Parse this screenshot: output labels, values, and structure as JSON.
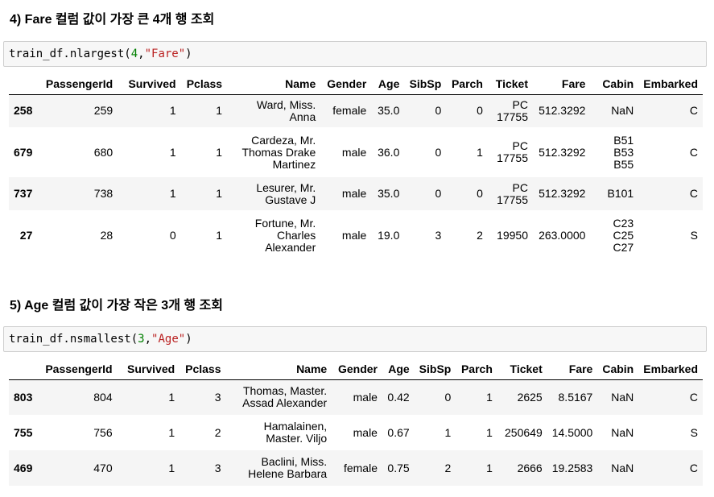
{
  "section4": {
    "heading": "4) Fare 컬럼 값이 가장 큰 4개 행 조회",
    "code": {
      "obj": "train_df.nlargest(",
      "num": "4",
      "comma": ",",
      "str": "\"Fare\"",
      "close": ")"
    },
    "columns": [
      "",
      "PassengerId",
      "Survived",
      "Pclass",
      "Name",
      "Gender",
      "Age",
      "SibSp",
      "Parch",
      "Ticket",
      "Fare",
      "Cabin",
      "Embarked"
    ],
    "rows": [
      [
        "258",
        "259",
        "1",
        "1",
        "Ward, Miss. Anna",
        "female",
        "35.0",
        "0",
        "0",
        "PC 17755",
        "512.3292",
        "NaN",
        "C"
      ],
      [
        "679",
        "680",
        "1",
        "1",
        "Cardeza, Mr. Thomas Drake Martinez",
        "male",
        "36.0",
        "0",
        "1",
        "PC 17755",
        "512.3292",
        "B51 B53 B55",
        "C"
      ],
      [
        "737",
        "738",
        "1",
        "1",
        "Lesurer, Mr. Gustave J",
        "male",
        "35.0",
        "0",
        "0",
        "PC 17755",
        "512.3292",
        "B101",
        "C"
      ],
      [
        "27",
        "28",
        "0",
        "1",
        "Fortune, Mr. Charles Alexander",
        "male",
        "19.0",
        "3",
        "2",
        "19950",
        "263.0000",
        "C23 C25 C27",
        "S"
      ]
    ]
  },
  "section5": {
    "heading": "5) Age 컬럼 값이 가장 작은 3개 행 조회",
    "code": {
      "obj": "train_df.nsmallest(",
      "num": "3",
      "comma": ",",
      "str": "\"Age\"",
      "close": ")"
    },
    "columns": [
      "",
      "PassengerId",
      "Survived",
      "Pclass",
      "Name",
      "Gender",
      "Age",
      "SibSp",
      "Parch",
      "Ticket",
      "Fare",
      "Cabin",
      "Embarked"
    ],
    "rows": [
      [
        "803",
        "804",
        "1",
        "3",
        "Thomas, Master. Assad Alexander",
        "male",
        "0.42",
        "0",
        "1",
        "2625",
        "8.5167",
        "NaN",
        "C"
      ],
      [
        "755",
        "756",
        "1",
        "2",
        "Hamalainen, Master. Viljo",
        "male",
        "0.67",
        "1",
        "1",
        "250649",
        "14.5000",
        "NaN",
        "S"
      ],
      [
        "469",
        "470",
        "1",
        "3",
        "Baclini, Miss. Helene Barbara",
        "female",
        "0.75",
        "2",
        "1",
        "2666",
        "19.2583",
        "NaN",
        "C"
      ]
    ]
  }
}
